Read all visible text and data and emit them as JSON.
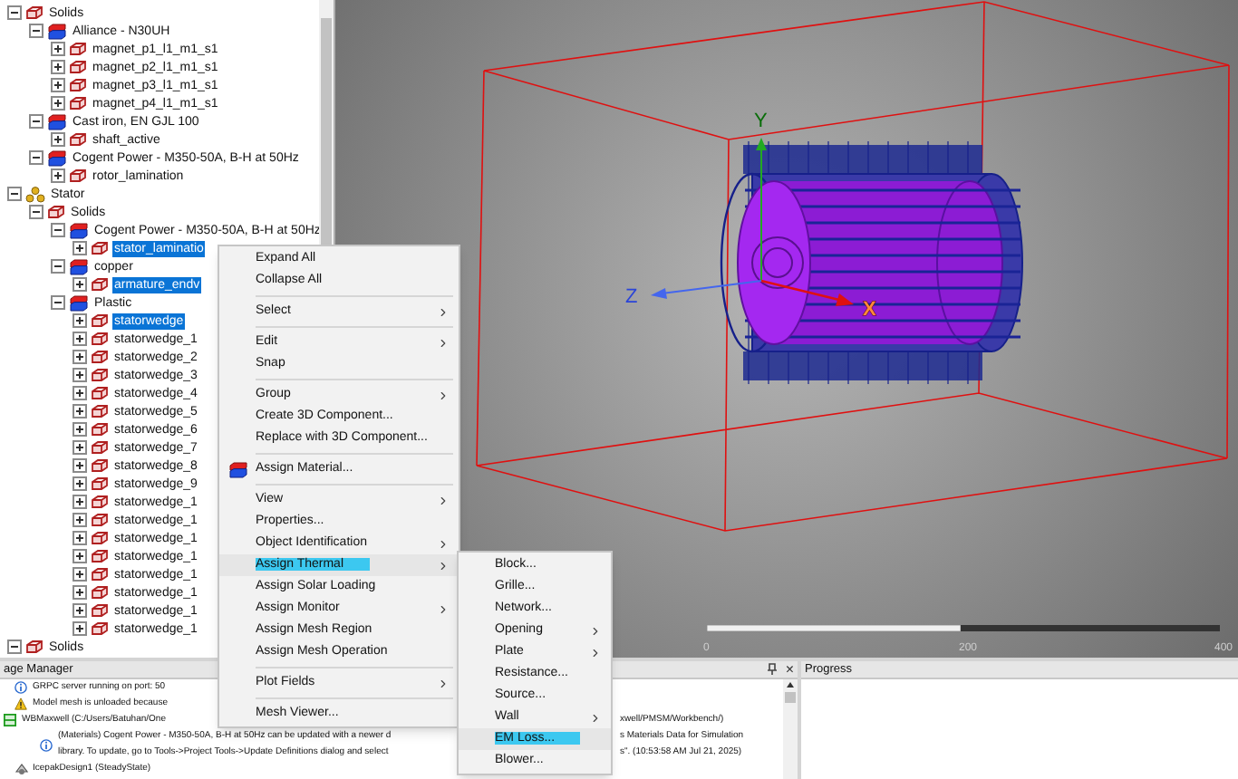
{
  "tree": {
    "items": [
      {
        "label": "Solids",
        "kind": "group",
        "expanded": true,
        "selected": false,
        "children": [
          {
            "label": "Alliance - N30UH",
            "kind": "material",
            "expanded": true,
            "selected": false,
            "children": [
              {
                "label": "magnet_p1_l1_m1_s1",
                "kind": "object",
                "expanded": false,
                "selected": false
              },
              {
                "label": "magnet_p2_l1_m1_s1",
                "kind": "object",
                "expanded": false,
                "selected": false
              },
              {
                "label": "magnet_p3_l1_m1_s1",
                "kind": "object",
                "expanded": false,
                "selected": false
              },
              {
                "label": "magnet_p4_l1_m1_s1",
                "kind": "object",
                "expanded": false,
                "selected": false
              }
            ]
          },
          {
            "label": "Cast iron, EN GJL 100",
            "kind": "material",
            "expanded": true,
            "selected": false,
            "children": [
              {
                "label": "shaft_active",
                "kind": "object",
                "expanded": false,
                "selected": false
              }
            ]
          },
          {
            "label": "Cogent Power - M350-50A, B-H at 50Hz",
            "kind": "material",
            "expanded": true,
            "selected": false,
            "children": [
              {
                "label": "rotor_lamination",
                "kind": "object",
                "expanded": false,
                "selected": false
              }
            ]
          }
        ]
      },
      {
        "label": "Stator",
        "kind": "component",
        "expanded": true,
        "selected": false,
        "children": [
          {
            "label": "Solids",
            "kind": "group",
            "expanded": true,
            "selected": false,
            "children": [
              {
                "label": "Cogent Power - M350-50A, B-H at 50Hz",
                "kind": "material",
                "expanded": true,
                "selected": false,
                "children": [
                  {
                    "label": "stator_laminatio",
                    "kind": "object",
                    "expanded": false,
                    "selected": true
                  }
                ]
              },
              {
                "label": "copper",
                "kind": "material",
                "expanded": true,
                "selected": false,
                "children": [
                  {
                    "label": "armature_endv",
                    "kind": "object",
                    "expanded": false,
                    "selected": true
                  }
                ]
              },
              {
                "label": "Plastic",
                "kind": "material",
                "expanded": true,
                "selected": false,
                "children": [
                  {
                    "label": "statorwedge",
                    "kind": "object",
                    "expanded": false,
                    "selected": true
                  },
                  {
                    "label": "statorwedge_1",
                    "kind": "object",
                    "expanded": false,
                    "selected": false
                  },
                  {
                    "label": "statorwedge_2",
                    "kind": "object",
                    "expanded": false,
                    "selected": false
                  },
                  {
                    "label": "statorwedge_3",
                    "kind": "object",
                    "expanded": false,
                    "selected": false
                  },
                  {
                    "label": "statorwedge_4",
                    "kind": "object",
                    "expanded": false,
                    "selected": false
                  },
                  {
                    "label": "statorwedge_5",
                    "kind": "object",
                    "expanded": false,
                    "selected": false
                  },
                  {
                    "label": "statorwedge_6",
                    "kind": "object",
                    "expanded": false,
                    "selected": false
                  },
                  {
                    "label": "statorwedge_7",
                    "kind": "object",
                    "expanded": false,
                    "selected": false
                  },
                  {
                    "label": "statorwedge_8",
                    "kind": "object",
                    "expanded": false,
                    "selected": false
                  },
                  {
                    "label": "statorwedge_9",
                    "kind": "object",
                    "expanded": false,
                    "selected": false
                  },
                  {
                    "label": "statorwedge_1",
                    "kind": "object",
                    "expanded": false,
                    "selected": false
                  },
                  {
                    "label": "statorwedge_1",
                    "kind": "object",
                    "expanded": false,
                    "selected": false
                  },
                  {
                    "label": "statorwedge_1",
                    "kind": "object",
                    "expanded": false,
                    "selected": false
                  },
                  {
                    "label": "statorwedge_1",
                    "kind": "object",
                    "expanded": false,
                    "selected": false
                  },
                  {
                    "label": "statorwedge_1",
                    "kind": "object",
                    "expanded": false,
                    "selected": false
                  },
                  {
                    "label": "statorwedge_1",
                    "kind": "object",
                    "expanded": false,
                    "selected": false
                  },
                  {
                    "label": "statorwedge_1",
                    "kind": "object",
                    "expanded": false,
                    "selected": false
                  },
                  {
                    "label": "statorwedge_1",
                    "kind": "object",
                    "expanded": false,
                    "selected": false
                  }
                ]
              }
            ]
          }
        ]
      },
      {
        "label": "Solids",
        "kind": "group",
        "expanded": true,
        "selected": false
      }
    ]
  },
  "context_menu": {
    "items": [
      {
        "kind": "item",
        "label": "Expand All",
        "submenu": false,
        "selected": false
      },
      {
        "kind": "item",
        "label": "Collapse All",
        "submenu": false,
        "selected": false
      },
      {
        "kind": "separator"
      },
      {
        "kind": "item",
        "label": "Select",
        "submenu": true,
        "selected": false
      },
      {
        "kind": "separator"
      },
      {
        "kind": "item",
        "label": "Edit",
        "submenu": true,
        "selected": false
      },
      {
        "kind": "item",
        "label": "Snap",
        "submenu": false,
        "selected": false
      },
      {
        "kind": "separator"
      },
      {
        "kind": "item",
        "label": "Group",
        "submenu": true,
        "selected": false
      },
      {
        "kind": "item",
        "label": "Create 3D Component...",
        "submenu": false,
        "selected": false
      },
      {
        "kind": "item",
        "label": "Replace with 3D Component...",
        "submenu": false,
        "selected": false
      },
      {
        "kind": "separator"
      },
      {
        "kind": "material_item",
        "label": "Assign Material...",
        "submenu": false,
        "selected": false
      },
      {
        "kind": "separator"
      },
      {
        "kind": "item",
        "label": "View",
        "submenu": true,
        "selected": false
      },
      {
        "kind": "item",
        "label": "Properties...",
        "submenu": false,
        "selected": false
      },
      {
        "kind": "item",
        "label": "Object Identification",
        "submenu": true,
        "selected": false
      },
      {
        "kind": "item",
        "label": "Assign Thermal",
        "submenu": true,
        "selected": true
      },
      {
        "kind": "item",
        "label": "Assign Solar Loading",
        "submenu": false,
        "selected": false
      },
      {
        "kind": "item",
        "label": "Assign Monitor",
        "submenu": true,
        "selected": false
      },
      {
        "kind": "item",
        "label": "Assign Mesh Region",
        "submenu": false,
        "selected": false
      },
      {
        "kind": "item",
        "label": "Assign Mesh Operation",
        "submenu": false,
        "selected": false
      },
      {
        "kind": "separator"
      },
      {
        "kind": "item",
        "label": "Plot Fields",
        "submenu": true,
        "selected": false
      },
      {
        "kind": "separator"
      },
      {
        "kind": "item",
        "label": "Mesh Viewer...",
        "submenu": false,
        "selected": false
      }
    ]
  },
  "submenu": {
    "items": [
      {
        "kind": "item",
        "label": "Block...",
        "submenu": false,
        "selected": false
      },
      {
        "kind": "item",
        "label": "Grille...",
        "submenu": false,
        "selected": false
      },
      {
        "kind": "item",
        "label": "Network...",
        "submenu": false,
        "selected": false
      },
      {
        "kind": "item",
        "label": "Opening",
        "submenu": true,
        "selected": false
      },
      {
        "kind": "item",
        "label": "Plate",
        "submenu": true,
        "selected": false
      },
      {
        "kind": "item",
        "label": "Resistance...",
        "submenu": false,
        "selected": false
      },
      {
        "kind": "item",
        "label": "Source...",
        "submenu": false,
        "selected": false
      },
      {
        "kind": "item",
        "label": "Wall",
        "submenu": true,
        "selected": false
      },
      {
        "kind": "item",
        "label": "EM Loss...",
        "submenu": false,
        "selected": true
      },
      {
        "kind": "item",
        "label": "Blower...",
        "submenu": false,
        "selected": false
      }
    ]
  },
  "viewport": {
    "axis_labels": {
      "x": "X",
      "y": "Y",
      "z": "Z"
    },
    "scale_labels": [
      "0",
      "200",
      "400"
    ]
  },
  "message_panel": {
    "title": "age Manager",
    "close": "×",
    "messages": [
      {
        "kind": "info",
        "lines": [
          {
            "left": "GRPC server running on port: 50"
          }
        ]
      },
      {
        "kind": "warning",
        "lines": [
          {
            "left": "Model mesh is unloaded because"
          }
        ]
      },
      {
        "kind": "project",
        "lines": [
          {
            "left": "WBMaxwell (C:/Users/Batuhan/One",
            "right": "xwell/PMSM/Workbench/)"
          }
        ],
        "children": [
          {
            "kind": "info",
            "lines": [
              {
                "left": "(Materials) Cogent Power - M350-50A, B-H at 50Hz can be updated with a newer d",
                "right": "s Materials Data for Simulation"
              },
              {
                "left": "library. To update, go to Tools->Project Tools->Update Definitions dialog and select",
                "right": "s\". (10:53:58 AM  Jul 21, 2025)"
              }
            ]
          }
        ]
      },
      {
        "kind": "design",
        "lines": [
          {
            "left": "IcepakDesign1 (SteadyState)"
          }
        ]
      }
    ]
  },
  "progress_panel": {
    "title": "Progress"
  }
}
